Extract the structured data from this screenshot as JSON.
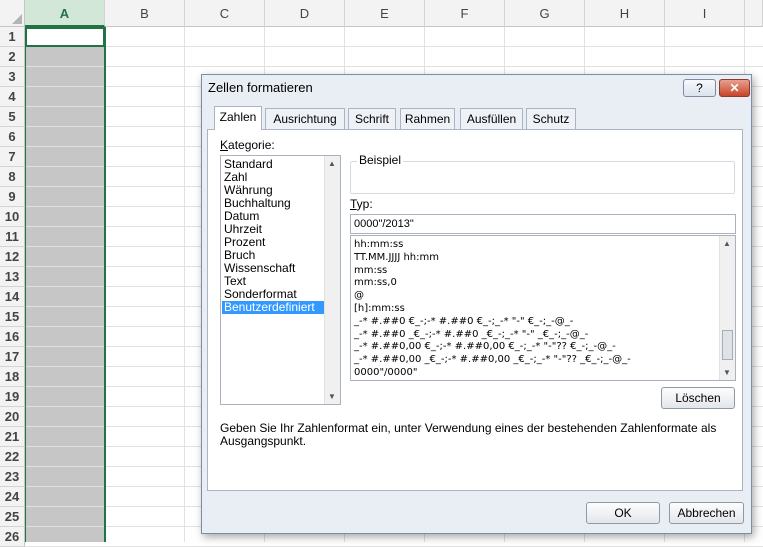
{
  "sheet": {
    "columns": [
      "A",
      "B",
      "C",
      "D",
      "E",
      "F",
      "G",
      "H",
      "I"
    ],
    "rows": [
      "1",
      "2",
      "3",
      "4",
      "5",
      "6",
      "7",
      "8",
      "9",
      "10",
      "11",
      "12",
      "13",
      "14",
      "15",
      "16",
      "17",
      "18",
      "19",
      "20",
      "21",
      "22",
      "23",
      "24",
      "25",
      "26"
    ],
    "selected_column": "A"
  },
  "dialog": {
    "title": "Zellen formatieren",
    "help_label": "?",
    "close_label": "✕",
    "tabs": [
      "Zahlen",
      "Ausrichtung",
      "Schrift",
      "Rahmen",
      "Ausfüllen",
      "Schutz"
    ],
    "active_tab": "Zahlen",
    "kategorie_label_first": "K",
    "kategorie_label_rest": "ategorie:",
    "categories": [
      "Standard",
      "Zahl",
      "Währung",
      "Buchhaltung",
      "Datum",
      "Uhrzeit",
      "Prozent",
      "Bruch",
      "Wissenschaft",
      "Text",
      "Sonderformat",
      "Benutzerdefiniert"
    ],
    "selected_category": "Benutzerdefiniert",
    "beispiel_label": "Beispiel",
    "typ_label_first": "T",
    "typ_label_rest": "yp:",
    "typ_value": "0000\"/2013\"",
    "formats": [
      "hh:mm:ss",
      "TT.MM.JJJJ hh:mm",
      "mm:ss",
      "mm:ss,0",
      "@",
      "[h]:mm:ss",
      "_-* #.##0 €_-;-* #.##0 €_-;_-* \"-\" €_-;_-@_-",
      "_-* #.##0 _€_-;-* #.##0 _€_-;_-* \"-\" _€_-;_-@_-",
      "_-* #.##0,00 €_-;-* #.##0,00 €_-;_-* \"-\"?? €_-;_-@_-",
      "_-* #.##0,00 _€_-;-* #.##0,00 _€_-;_-* \"-\"?? _€_-;_-@_-",
      "0000\"/0000\""
    ],
    "delete_label": "Löschen",
    "description": "Geben Sie Ihr Zahlenformat ein, unter Verwendung eines der bestehenden Zahlenformate als Ausgangspunkt.",
    "ok_label": "OK",
    "cancel_label": "Abbrechen"
  },
  "colors": {
    "excel_green": "#217346",
    "selection_blue": "#3399ff",
    "column_fill": "#c6c6c6"
  }
}
